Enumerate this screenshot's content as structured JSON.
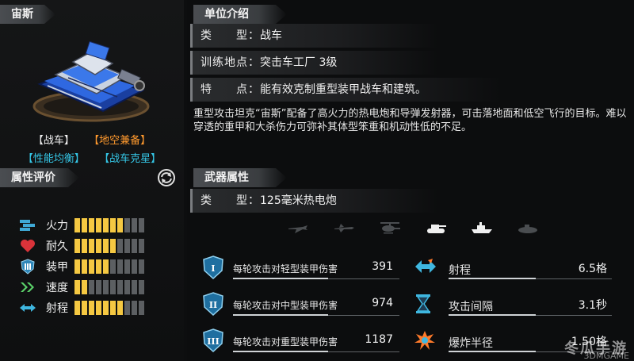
{
  "left": {
    "unit_name": "宙斯",
    "badges_row1": [
      "【战车】",
      "【地空兼备】"
    ],
    "badges_row2": [
      "【性能均衡】",
      "【战车克星】"
    ],
    "attr_title": "属性评价",
    "attributes": [
      {
        "icon": "firepower-icon",
        "label": "火力",
        "level": 7,
        "max": 10
      },
      {
        "icon": "heart-icon",
        "label": "耐久",
        "level": 6,
        "max": 10
      },
      {
        "icon": "armor-icon",
        "label": "装甲",
        "level": 5,
        "max": 10
      },
      {
        "icon": "speed-icon",
        "label": "速度",
        "level": 2,
        "max": 10
      },
      {
        "icon": "range-icon",
        "label": "射程",
        "level": 7,
        "max": 10
      }
    ]
  },
  "right": {
    "intro_title": "单位介绍",
    "type_label": "类　　型：",
    "type_value": "战车",
    "train_label": "训练地点：",
    "train_value": "突击车工厂 3级",
    "feature_label": "特　　点：",
    "feature_value": "能有效克制重型装甲战车和建筑。",
    "description": "重型攻击坦克“宙斯”配备了高火力的热电炮和导弹发射器，可击落地面和低空飞行的目标。难以穿透的重甲和大杀伤力可弥补其体型笨重和机动性低的不足。",
    "weapon_title": "武器属性",
    "weapon_type_label": "类　　型：",
    "weapon_type_value": "125毫米热电炮",
    "target_icons": [
      "jet-icon",
      "plane-icon",
      "helicopter-icon",
      "tank-icon",
      "ship-icon",
      "submarine-icon"
    ],
    "active_targets": [
      "tank-icon",
      "ship-icon"
    ],
    "stats_left": [
      {
        "roman": "I",
        "name": "每轮攻击对轻型装甲伤害",
        "value": "391"
      },
      {
        "roman": "II",
        "name": "每轮攻击对中型装甲伤害",
        "value": "974"
      },
      {
        "roman": "III",
        "name": "每轮攻击对重型装甲伤害",
        "value": "1187"
      }
    ],
    "stats_right": [
      {
        "icon": "range-icon",
        "name": "射程",
        "value": "6.5格"
      },
      {
        "icon": "hourglass-icon",
        "name": "攻击间隔",
        "value": "3.1秒"
      },
      {
        "icon": "explosion-icon",
        "name": "爆炸半径",
        "value": "1.50格"
      }
    ]
  },
  "watermark": {
    "text": "冬瓜手游",
    "sub": "3DMGAME"
  },
  "colors": {
    "bar_on": "#f5c842",
    "bar_off": "#5c5f62",
    "badge_orange": "#ff9a2e",
    "badge_cyan": "#35c8e8",
    "badge_white": "#f2f2f2"
  }
}
